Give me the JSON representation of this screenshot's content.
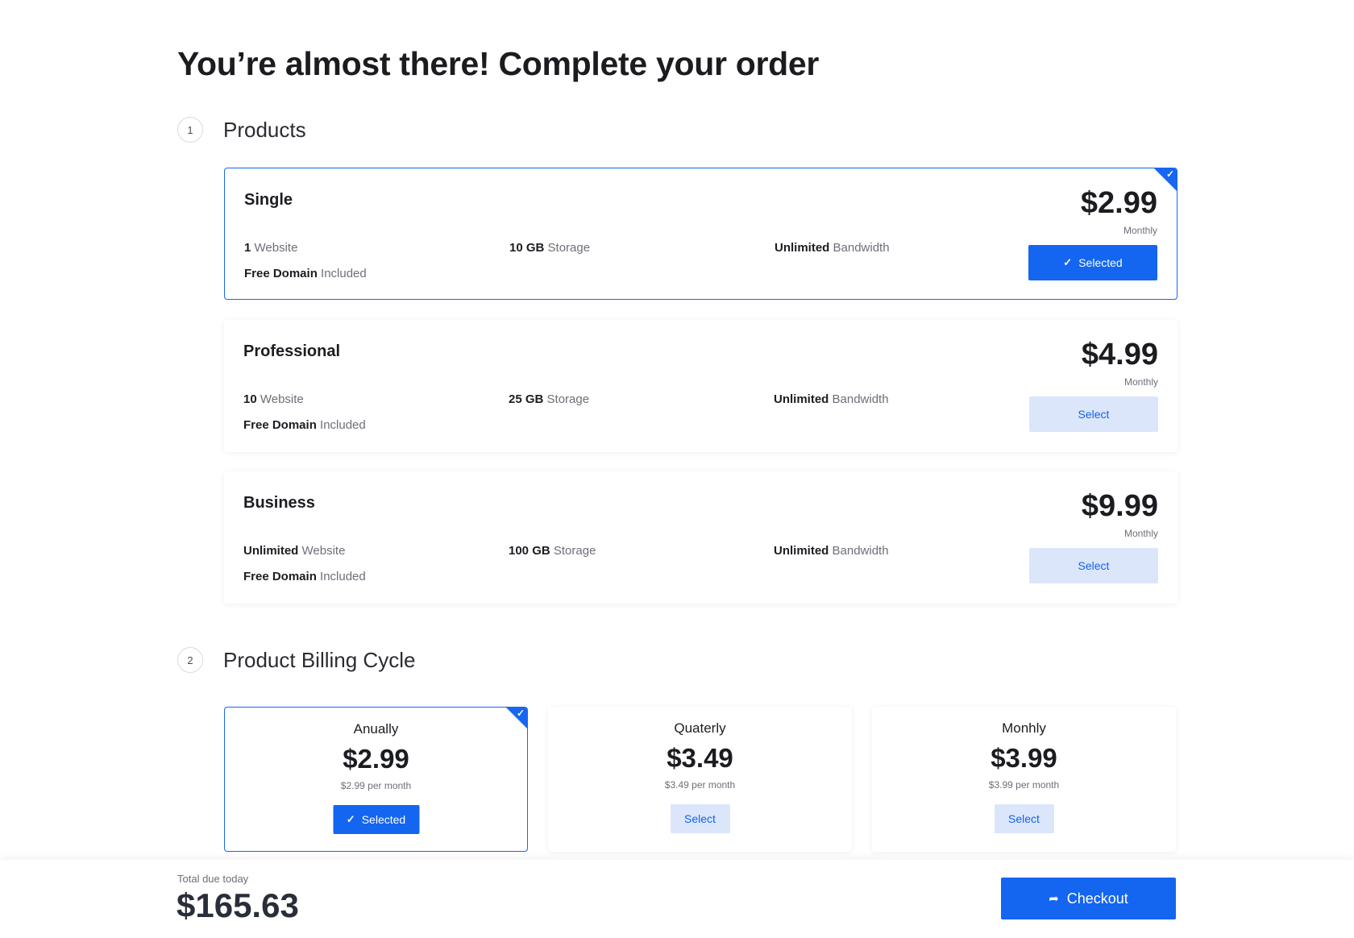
{
  "header": {
    "title": "You’re almost there! Complete your order"
  },
  "steps": [
    {
      "number": "1",
      "title": "Products"
    },
    {
      "number": "2",
      "title": "Product Billing Cycle"
    }
  ],
  "plans": [
    {
      "name": "Single",
      "price": "$2.99",
      "period": "Monthly",
      "selected": true,
      "button_label": "Selected",
      "features": [
        {
          "bold": "1",
          "text": " Website"
        },
        {
          "bold": "10 GB",
          "text": " Storage"
        },
        {
          "bold": "Unlimited",
          "text": " Bandwidth"
        },
        {
          "bold": "Free Domain",
          "text": " Included"
        }
      ]
    },
    {
      "name": "Professional",
      "price": "$4.99",
      "period": "Monthly",
      "selected": false,
      "button_label": "Select",
      "features": [
        {
          "bold": "10",
          "text": " Website"
        },
        {
          "bold": "25 GB",
          "text": " Storage"
        },
        {
          "bold": "Unlimited",
          "text": " Bandwidth"
        },
        {
          "bold": "Free Domain",
          "text": " Included"
        }
      ]
    },
    {
      "name": "Business",
      "price": "$9.99",
      "period": "Monthly",
      "selected": false,
      "button_label": "Select",
      "features": [
        {
          "bold": "Unlimited",
          "text": " Website"
        },
        {
          "bold": "100 GB",
          "text": " Storage"
        },
        {
          "bold": "Unlimited",
          "text": " Bandwidth"
        },
        {
          "bold": "Free Domain",
          "text": " Included"
        }
      ]
    }
  ],
  "billing_cycles": [
    {
      "name": "Anually",
      "price": "$2.99",
      "per_month": "$2.99 per month",
      "selected": true,
      "button_label": "Selected"
    },
    {
      "name": "Quaterly",
      "price": "$3.49",
      "per_month": "$3.49 per month",
      "selected": false,
      "button_label": "Select"
    },
    {
      "name": "Monhly",
      "price": "$3.99",
      "per_month": "$3.99 per month",
      "selected": false,
      "button_label": "Select"
    }
  ],
  "footer": {
    "total_label": "Total due today",
    "total_value": "$165.63",
    "checkout_label": "Checkout"
  },
  "icons": {
    "selected": "check-icon",
    "checkout": "arrow-right-icon"
  },
  "colors": {
    "accent": "#1465f0",
    "soft_button": "#dbe6fb",
    "text": "#1b1c20"
  }
}
